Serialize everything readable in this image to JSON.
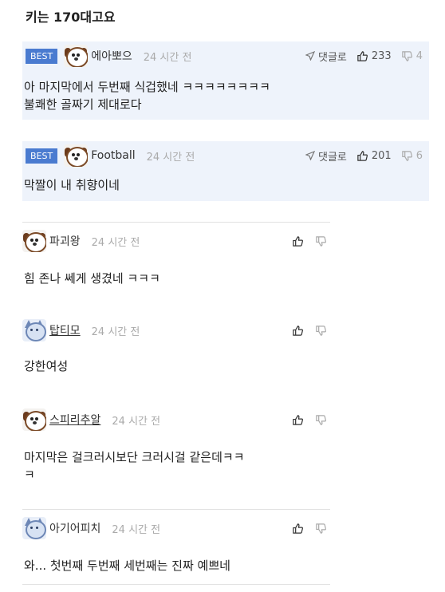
{
  "prev_text": "키는 170대고요",
  "best_comments": [
    {
      "badge": "BEST",
      "nick": "에아뽀으",
      "time": "24 시간 전",
      "reply_label": "댓글로",
      "likes": "233",
      "dislikes": "4",
      "lines": [
        "아 마지막에서 두번째 식겁했네 ㅋㅋㅋㅋㅋㅋㅋㅋ",
        "불쾌한 골짜기 제대로다"
      ]
    },
    {
      "badge": "BEST",
      "nick": "Football",
      "time": "24 시간 전",
      "reply_label": "댓글로",
      "likes": "201",
      "dislikes": "6",
      "lines": [
        "막짤이 내 취향이네"
      ]
    }
  ],
  "comments": [
    {
      "nick": "파괴왕",
      "time": "24 시간 전",
      "lines": [
        "힘 존나 쎄게 생겼네 ㅋㅋㅋ"
      ],
      "avatar": "dog-icon"
    },
    {
      "nick": "탑티모",
      "time": "24 시간 전",
      "lines": [
        "강한여성"
      ],
      "avatar": "cat-icon"
    },
    {
      "nick": "스피리추알",
      "time": "24 시간 전",
      "lines": [
        "마지막은 걸크러시보단 크러시걸 같은데ㅋㅋ",
        "ㅋ"
      ],
      "avatar": "dog-icon"
    },
    {
      "nick": "아기어피치",
      "time": "24 시간 전",
      "lines": [
        "와... 첫번째 두번째 세번째는 진짜 예쁘네"
      ],
      "avatar": "cat-icon"
    }
  ],
  "colors": {
    "best_bg": "#eef3fb",
    "badge": "#4a7bd0"
  }
}
